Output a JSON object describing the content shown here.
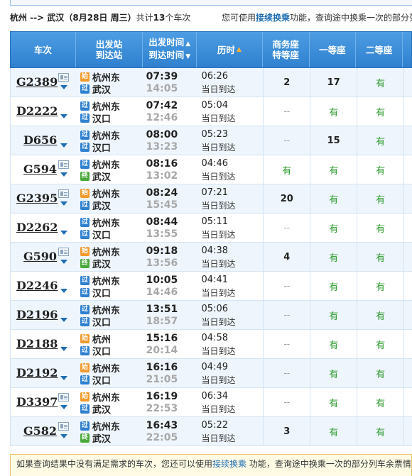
{
  "summary": {
    "route": "杭州 --> 武汉",
    "date": "（8月28日  周三）",
    "count_prefix": "共计",
    "count": "13",
    "count_suffix": "个车次",
    "hint_prefix": "您可使用",
    "hint_link": "接续换乘",
    "hint_suffix": "功能，查询途中换乘一次的部分列"
  },
  "columns": {
    "train": "车次",
    "station_dep": "出发站",
    "station_arr": "到达站",
    "time_dep": "出发时间",
    "time_arr": "到达时间",
    "duration": "历时",
    "biz_1": "商务座",
    "biz_2": "特等座",
    "first": "一等座",
    "second": "二等座"
  },
  "rows": [
    {
      "train": "G2389",
      "card": true,
      "dep_tag": "始",
      "dep": "杭州东",
      "arr_tag": "过",
      "arr": "武汉",
      "dep_time": "07:39",
      "arr_time": "14:05",
      "duration": "06:26",
      "note": "当日到达",
      "biz": "2",
      "first": "17",
      "second": "有"
    },
    {
      "train": "D2222",
      "card": false,
      "dep_tag": "过",
      "dep": "杭州东",
      "arr_tag": "过",
      "arr": "汉口",
      "dep_time": "07:42",
      "arr_time": "12:46",
      "duration": "05:04",
      "note": "当日到达",
      "biz": "--",
      "first": "有",
      "second": "有"
    },
    {
      "train": "D656",
      "card": false,
      "dep_tag": "过",
      "dep": "杭州东",
      "arr_tag": "过",
      "arr": "汉口",
      "dep_time": "08:00",
      "arr_time": "13:23",
      "duration": "05:23",
      "note": "当日到达",
      "biz": "--",
      "first": "15",
      "second": "有"
    },
    {
      "train": "G594",
      "card": true,
      "dep_tag": "过",
      "dep": "杭州东",
      "arr_tag": "终",
      "arr": "武汉",
      "dep_time": "08:16",
      "arr_time": "13:02",
      "duration": "04:46",
      "note": "当日到达",
      "biz": "有",
      "first": "有",
      "second": "有"
    },
    {
      "train": "G2395",
      "card": true,
      "dep_tag": "始",
      "dep": "杭州东",
      "arr_tag": "过",
      "arr": "武汉",
      "dep_time": "08:24",
      "arr_time": "15:45",
      "duration": "07:21",
      "note": "当日到达",
      "biz": "20",
      "first": "有",
      "second": "有"
    },
    {
      "train": "D2262",
      "card": false,
      "dep_tag": "过",
      "dep": "杭州东",
      "arr_tag": "过",
      "arr": "汉口",
      "dep_time": "08:44",
      "arr_time": "13:55",
      "duration": "05:11",
      "note": "当日到达",
      "biz": "--",
      "first": "有",
      "second": "有"
    },
    {
      "train": "G590",
      "card": true,
      "dep_tag": "始",
      "dep": "杭州东",
      "arr_tag": "终",
      "arr": "武汉",
      "dep_time": "09:18",
      "arr_time": "13:56",
      "duration": "04:38",
      "note": "当日到达",
      "biz": "4",
      "first": "有",
      "second": "有"
    },
    {
      "train": "D2246",
      "card": false,
      "dep_tag": "过",
      "dep": "杭州东",
      "arr_tag": "过",
      "arr": "汉口",
      "dep_time": "10:05",
      "arr_time": "14:46",
      "duration": "04:41",
      "note": "当日到达",
      "biz": "--",
      "first": "有",
      "second": "有"
    },
    {
      "train": "D2196",
      "card": false,
      "dep_tag": "过",
      "dep": "杭州东",
      "arr_tag": "过",
      "arr": "汉口",
      "dep_time": "13:51",
      "arr_time": "18:57",
      "duration": "05:06",
      "note": "当日到达",
      "biz": "--",
      "first": "有",
      "second": "有"
    },
    {
      "train": "D2188",
      "card": false,
      "dep_tag": "始",
      "dep": "杭州",
      "arr_tag": "过",
      "arr": "汉口",
      "dep_time": "15:16",
      "arr_time": "20:14",
      "duration": "04:58",
      "note": "当日到达",
      "biz": "--",
      "first": "有",
      "second": "有"
    },
    {
      "train": "D2192",
      "card": false,
      "dep_tag": "始",
      "dep": "杭州东",
      "arr_tag": "过",
      "arr": "汉口",
      "dep_time": "16:16",
      "arr_time": "21:05",
      "duration": "04:49",
      "note": "当日到达",
      "biz": "--",
      "first": "有",
      "second": "有"
    },
    {
      "train": "D3397",
      "card": true,
      "dep_tag": "始",
      "dep": "杭州东",
      "arr_tag": "过",
      "arr": "武汉",
      "dep_time": "16:19",
      "arr_time": "22:53",
      "duration": "06:34",
      "note": "当日到达",
      "biz": "--",
      "first": "有",
      "second": "有"
    },
    {
      "train": "G582",
      "card": true,
      "dep_tag": "过",
      "dep": "杭州东",
      "arr_tag": "终",
      "arr": "武汉",
      "dep_time": "16:43",
      "arr_time": "22:05",
      "duration": "05:22",
      "note": "当日到达",
      "biz": "3",
      "first": "有",
      "second": "有"
    }
  ],
  "notice": {
    "prefix": "如果查询结果中没有满足需求的车次，您还可以使用",
    "link": "接续换乘",
    "suffix": " 功能，查询途中换乘一次的部分列车余票情况。"
  },
  "colors": {
    "header_blue": "#2f80cf",
    "tag_orange": "#f39a2b",
    "tag_blue": "#2f80cf",
    "tag_green": "#49a83a",
    "available_green": "#2b9a2b",
    "sort_active": "#ffb33a"
  }
}
